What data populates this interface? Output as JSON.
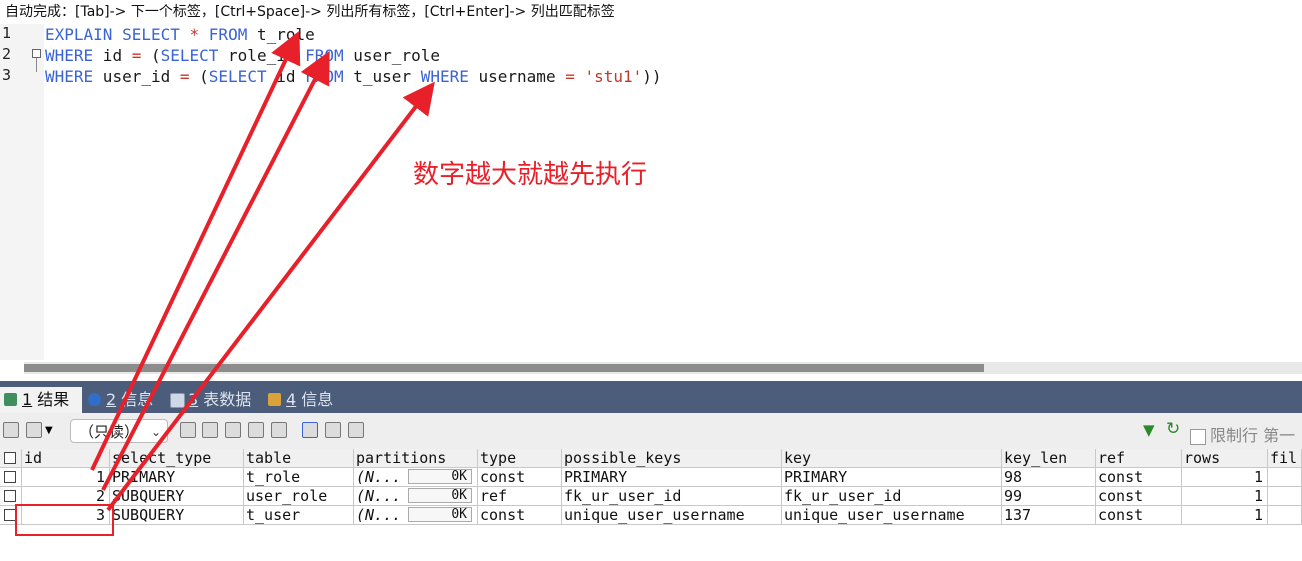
{
  "hint_bar": {
    "text": "自动完成：[Tab]-> 下一个标签，[Ctrl+Space]-> 列出所有标签，[Ctrl+Enter]-> 列出匹配标签"
  },
  "editor": {
    "line_numbers": [
      "1",
      "2",
      "3"
    ],
    "lines": [
      [
        {
          "t": "EXPLAIN",
          "c": "kw"
        },
        {
          "t": " "
        },
        {
          "t": "SELECT",
          "c": "kw"
        },
        {
          "t": " "
        },
        {
          "t": "*",
          "c": "op"
        },
        {
          "t": " "
        },
        {
          "t": "FROM",
          "c": "kw"
        },
        {
          "t": " t_role"
        }
      ],
      [
        {
          "t": "WHERE",
          "c": "kw"
        },
        {
          "t": " id "
        },
        {
          "t": "=",
          "c": "op"
        },
        {
          "t": " ("
        },
        {
          "t": "SELECT",
          "c": "kw"
        },
        {
          "t": " role_id "
        },
        {
          "t": "FROM",
          "c": "kw"
        },
        {
          "t": " user_role"
        }
      ],
      [
        {
          "t": "WHERE",
          "c": "kw"
        },
        {
          "t": " user_id "
        },
        {
          "t": "=",
          "c": "op"
        },
        {
          "t": " ("
        },
        {
          "t": "SELECT",
          "c": "kw"
        },
        {
          "t": " id "
        },
        {
          "t": "FROM",
          "c": "kw"
        },
        {
          "t": " t_user "
        },
        {
          "t": "WHERE",
          "c": "kw"
        },
        {
          "t": " username "
        },
        {
          "t": "=",
          "c": "op"
        },
        {
          "t": " "
        },
        {
          "t": "'stu1'",
          "c": "str"
        },
        {
          "t": "))"
        }
      ]
    ],
    "fold_markers": [
      "⊟",
      "└"
    ]
  },
  "annotation": {
    "text": "数字越大就越先执行",
    "color": "#e8202a"
  },
  "result_tabs": [
    {
      "num": "1",
      "label": "结果",
      "icon": "table-icon",
      "active": true
    },
    {
      "num": "2",
      "label": "信息",
      "icon": "info-icon",
      "active": false
    },
    {
      "num": "3",
      "label": "表数据",
      "icon": "grid-icon",
      "active": false
    },
    {
      "num": "4",
      "label": "信息",
      "icon": "chart-icon",
      "active": false
    }
  ],
  "toolbar": {
    "mode_select": "（只读）",
    "limit_label": "限制行",
    "first_label": "第一"
  },
  "table": {
    "columns": [
      "id",
      "select_type",
      "table",
      "partitions",
      "type",
      "possible_keys",
      "key",
      "key_len",
      "ref",
      "rows",
      "fil"
    ],
    "rows": [
      {
        "id": "1",
        "select_type": "PRIMARY",
        "table": "t_role",
        "partitions": "(N...",
        "partitions_size": "0K",
        "type": "const",
        "possible_keys": "PRIMARY",
        "key": "PRIMARY",
        "key_len": "98",
        "ref": "const",
        "rows": "1"
      },
      {
        "id": "2",
        "select_type": "SUBQUERY",
        "table": "user_role",
        "partitions": "(N...",
        "partitions_size": "0K",
        "type": "ref",
        "possible_keys": "fk_ur_user_id",
        "key": "fk_ur_user_id",
        "key_len": "99",
        "ref": "const",
        "rows": "1"
      },
      {
        "id": "3",
        "select_type": "SUBQUERY",
        "table": "t_user",
        "partitions": "(N...",
        "partitions_size": "0K",
        "type": "const",
        "possible_keys": "unique_user_username",
        "key": "unique_user_username",
        "key_len": "137",
        "ref": "const",
        "rows": "1"
      }
    ]
  },
  "colors": {
    "keyword": "#3a64d4",
    "operator": "#c0392b",
    "arrow": "#e8202a",
    "tabbar": "#4b5d7a"
  }
}
